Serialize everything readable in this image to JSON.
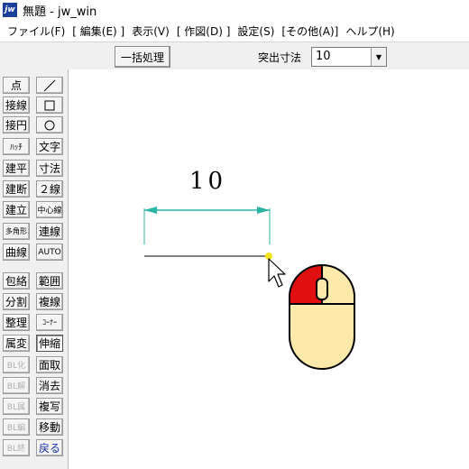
{
  "window": {
    "app_icon": "jw",
    "title": "無題 - jw_win"
  },
  "menu": [
    "ファイル(F)",
    "[ 編集(E) ]",
    "表示(V)",
    "[ 作図(D) ]",
    "設定(S)",
    "[その他(A)]",
    "ヘルプ(H)"
  ],
  "toolbar": {
    "batch_label": "一括処理",
    "protrude_label": "突出寸法",
    "protrude_value": "10"
  },
  "tools_left": [
    "点",
    "接線",
    "接円",
    "ﾊｯﾁ",
    "建平",
    "建断",
    "建立",
    "多角形",
    "曲線",
    "包絡",
    "分割",
    "整理",
    "属変",
    "BL化",
    "BL解",
    "BL属",
    "BL編",
    "BL終"
  ],
  "tools_right": [
    "/",
    "□",
    "○",
    "文字",
    "寸法",
    "２線",
    "中心線",
    "連線",
    "AUTO",
    "範囲",
    "複線",
    "ｺｰﾅｰ",
    "伸縮",
    "面取",
    "消去",
    "複写",
    "移動",
    "戻る"
  ],
  "drawing": {
    "dimension_value": "10"
  },
  "icons": {
    "dropdown": "chevron-down-icon",
    "cursor": "arrow-cursor-icon",
    "mouse": "mouse-left-click-icon"
  },
  "colors": {
    "dimension_line": "#2ab5a3",
    "snap_point": "#f2e21a",
    "mouse_button": "#e01010",
    "mouse_body": "#fde9a9"
  }
}
